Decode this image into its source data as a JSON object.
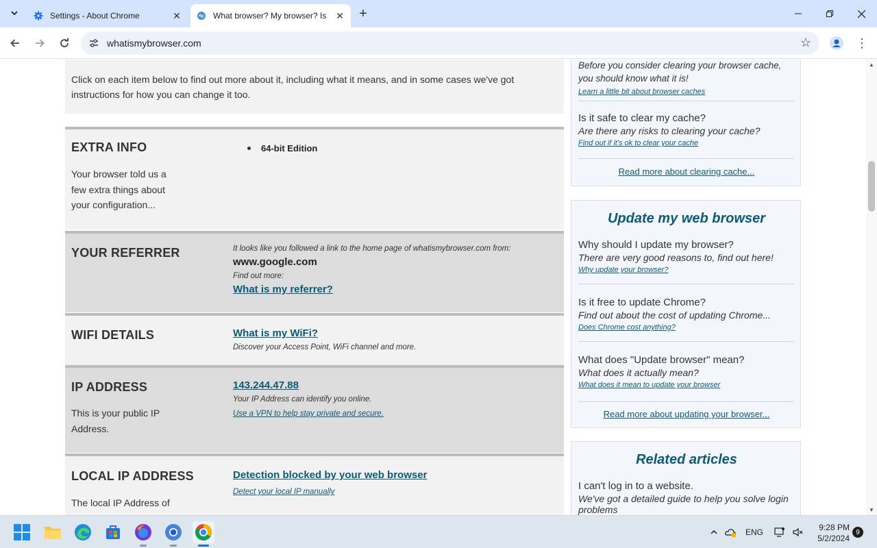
{
  "tabs": [
    {
      "title": "Settings - About Chrome",
      "icon": "gear-icon"
    },
    {
      "title": "What browser? My browser? Is",
      "icon": "globe-icon"
    }
  ],
  "toolbar": {
    "url": "whatismybrowser.com"
  },
  "intro": {
    "text": "Click on each item below to find out more about it, including what it means, and in some cases we've got instructions for how you can change it too."
  },
  "rows": {
    "extra_info": {
      "title": "EXTRA INFO",
      "desc": "Your browser told us a few extra things about your configuration...",
      "item": "64-bit Edition"
    },
    "referrer": {
      "title": "YOUR REFERRER",
      "lead": "It looks like you followed a link to the home page of whatismybrowser.com from:",
      "value": "www.google.com",
      "find_more": "Find out more:",
      "link": "What is my referrer?"
    },
    "wifi": {
      "title": "WIFI DETAILS",
      "link": "What is my WiFi?",
      "desc": "Discover your Access Point, WiFi channel and more."
    },
    "ip": {
      "title": "IP ADDRESS",
      "desc": "This is your public IP Address.",
      "value": "143.244.47.88",
      "note": "Your IP Address can identify you online.",
      "link": "Use a VPN to help stay private and secure."
    },
    "local_ip": {
      "title": "LOCAL IP ADDRESS",
      "desc": "The local IP Address of",
      "link": "Detection blocked by your web browser",
      "sublink": "Detect your local IP manually"
    }
  },
  "sidebar": {
    "cache": {
      "partial_answer": "Before you consider clearing your browser cache, you should know what it is!",
      "partial_link": "Learn a little bit about browser caches",
      "q2": "Is it safe to clear my cache?",
      "a2": "Are there any risks to clearing your cache?",
      "l2": "Find out if it's ok to clear your cache",
      "readmore": "Read more about clearing cache..."
    },
    "update": {
      "heading": "Update my web browser",
      "items": [
        {
          "q": "Why should I update my browser?",
          "a": "There are very good reasons to, find out here!",
          "l": "Why update your browser?"
        },
        {
          "q": "Is it free to update Chrome?",
          "a": "Find out about the cost of updating Chrome...",
          "l": "Does Chrome cost anything?"
        },
        {
          "q": "What does \"Update browser\" mean?",
          "a": "What does it actually mean?",
          "l": "What does it mean to update your browser"
        }
      ],
      "readmore": "Read more about updating your browser..."
    },
    "related": {
      "heading": "Related articles",
      "q": "I can't log in to a website.",
      "a": "We've got a detailed guide to help you solve login problems"
    }
  },
  "taskbar": {
    "lang": "ENG",
    "time": "9:28 PM",
    "date": "5/2/2024",
    "notifications": "9"
  },
  "colors": {
    "link": "#0c5a78",
    "tabstrip": "#d3e3fd",
    "accent": "#1f6fc5"
  }
}
